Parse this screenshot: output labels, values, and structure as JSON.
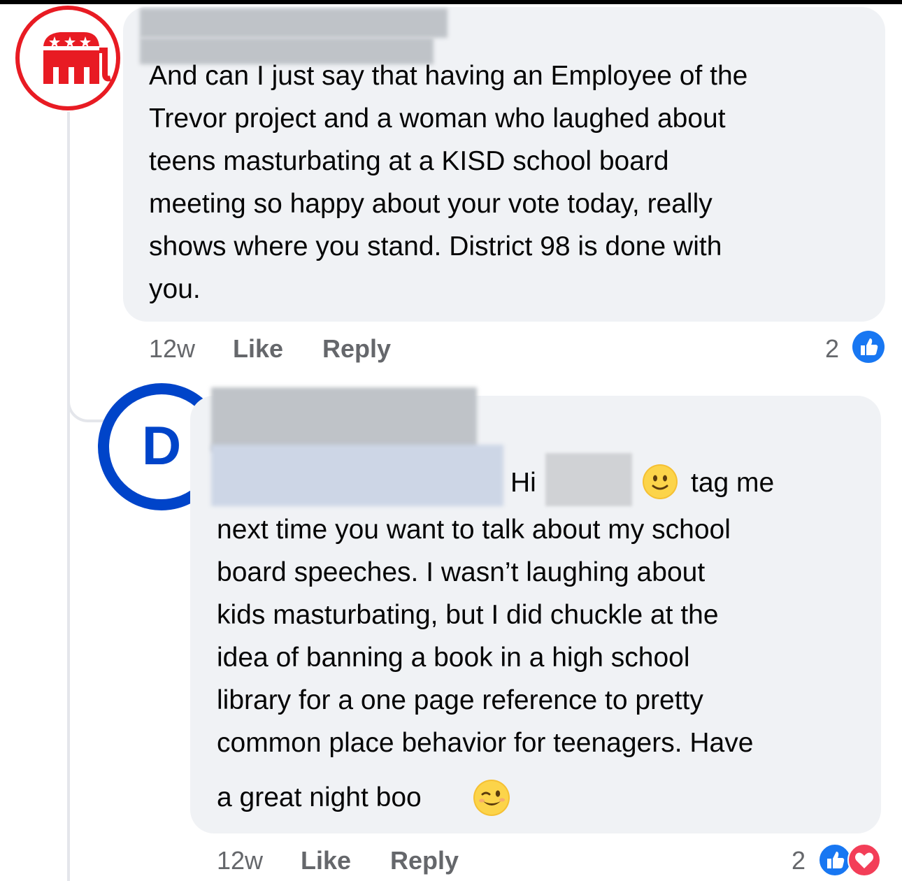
{
  "comment1": {
    "avatar_icon": "gop-elephant-icon",
    "lines": [
      "And can I just say that having an Employee of the",
      "Trevor project and a woman who laughed about",
      "teens masturbating at a KISD school board",
      "meeting so happy about your vote today, really",
      "shows where you stand. District 98 is done with",
      "you."
    ],
    "time": "12w",
    "like_label": "Like",
    "reply_label": "Reply",
    "reaction_count": "2",
    "reactions": [
      "like-icon"
    ]
  },
  "comment2": {
    "avatar_icon": "democratic-d-icon",
    "avatar_letter": "D",
    "first_line_prefix": "Hi",
    "first_line_suffix": "tag me",
    "lines": [
      "next time you want to talk about my school",
      "board speeches. I wasn’t laughing about",
      "kids masturbating, but I did chuckle at the",
      "idea of banning a book in a high school",
      "library for a one page reference to pretty",
      "common place behavior for teenagers. Have"
    ],
    "last_line": "a great night boo",
    "time": "12w",
    "like_label": "Like",
    "reply_label": "Reply",
    "reaction_count": "2",
    "reactions": [
      "like-icon",
      "love-icon"
    ]
  },
  "colors": {
    "bubble": "#f0f2f5",
    "meta": "#65676b",
    "gop_red": "#e81b23",
    "dem_blue": "#0044c9",
    "like_blue": "#1877f2",
    "love_red": "#f33e58"
  }
}
